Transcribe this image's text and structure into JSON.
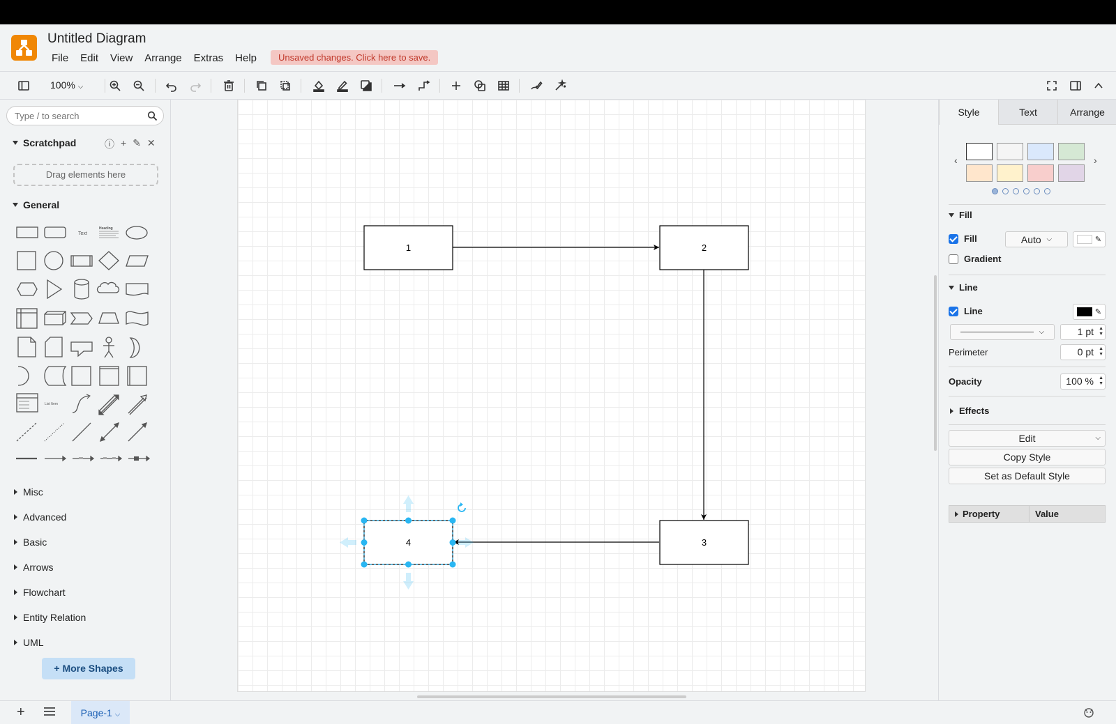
{
  "app": {
    "title": "Untitled Diagram",
    "unsaved_notice": "Unsaved changes. Click here to save.",
    "brand_color": "#f08705"
  },
  "menu": [
    "File",
    "Edit",
    "View",
    "Arrange",
    "Extras",
    "Help"
  ],
  "toolbar": {
    "zoom": "100%",
    "icons": [
      "sidebar-toggle-icon",
      "zoom-in-icon",
      "zoom-out-icon",
      "undo-icon",
      "redo-icon",
      "delete-icon",
      "to-front-icon",
      "to-back-icon",
      "fill-color-icon",
      "line-color-icon",
      "shadow-icon",
      "connection-icon",
      "waypoints-icon",
      "insert-icon",
      "shapes-icon",
      "table-icon",
      "freehand-icon",
      "magic-icon",
      "fullscreen-icon",
      "format-panel-icon",
      "collapse-icon"
    ]
  },
  "sidebar": {
    "search_placeholder": "Type / to search",
    "scratchpad": "Scratchpad",
    "drop_hint": "Drag elements here",
    "general": "General",
    "shape_text": "Text",
    "shape_heading": "Heading",
    "shape_list_item": "List Item",
    "collapsed_sections": [
      "Misc",
      "Advanced",
      "Basic",
      "Arrows",
      "Flowchart",
      "Entity Relation",
      "UML"
    ],
    "more_shapes": "More Shapes"
  },
  "diagram": {
    "nodes": [
      {
        "label": "1"
      },
      {
        "label": "2"
      },
      {
        "label": "3"
      },
      {
        "label": "4",
        "selected": true
      }
    ],
    "selection_color": "#29b6f2"
  },
  "format_panel": {
    "tabs": [
      "Style",
      "Text",
      "Arrange"
    ],
    "active_tab": "Style",
    "swatch_colors": [
      "#ffffff",
      "#f5f5f5",
      "#dae8fc",
      "#d5e8d4",
      "#ffe6cc",
      "#fff2cc",
      "#f8cecc",
      "#e1d5e7"
    ],
    "fill_section": "Fill",
    "fill_label": "Fill",
    "fill_checked": true,
    "fill_mode": "Auto",
    "gradient_label": "Gradient",
    "gradient_checked": false,
    "line_section": "Line",
    "line_label": "Line",
    "line_checked": true,
    "line_color": "#000000",
    "line_width": "1 pt",
    "perimeter_label": "Perimeter",
    "perimeter_value": "0 pt",
    "opacity_label": "Opacity",
    "opacity_value": "100 %",
    "effects_section": "Effects",
    "edit_button": "Edit",
    "copy_style_button": "Copy Style",
    "default_style_button": "Set as Default Style",
    "property_col": "Property",
    "value_col": "Value"
  },
  "pages": {
    "current": "Page-1"
  }
}
